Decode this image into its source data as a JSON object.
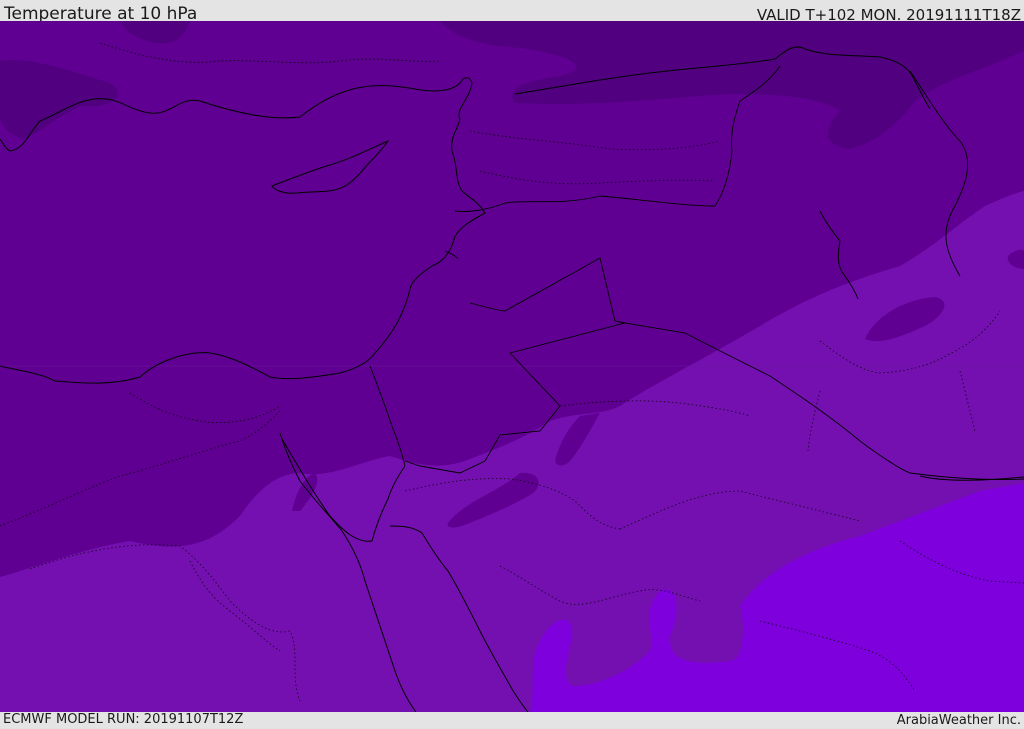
{
  "header": {
    "title": "Temperature at 10 hPa",
    "valid_time": "VALID T+102 MON. 20191111T18Z"
  },
  "footer": {
    "model_run": "ECMWF MODEL RUN: 20191107T12Z",
    "credit": "ArabiaWeather Inc."
  },
  "map": {
    "field": "Temperature",
    "level": "10 hPa",
    "palette": {
      "darkest": "#510080",
      "dark": "#600092",
      "medium": "#7410b0",
      "bright": "#7e00dc",
      "border": "#000000"
    }
  }
}
